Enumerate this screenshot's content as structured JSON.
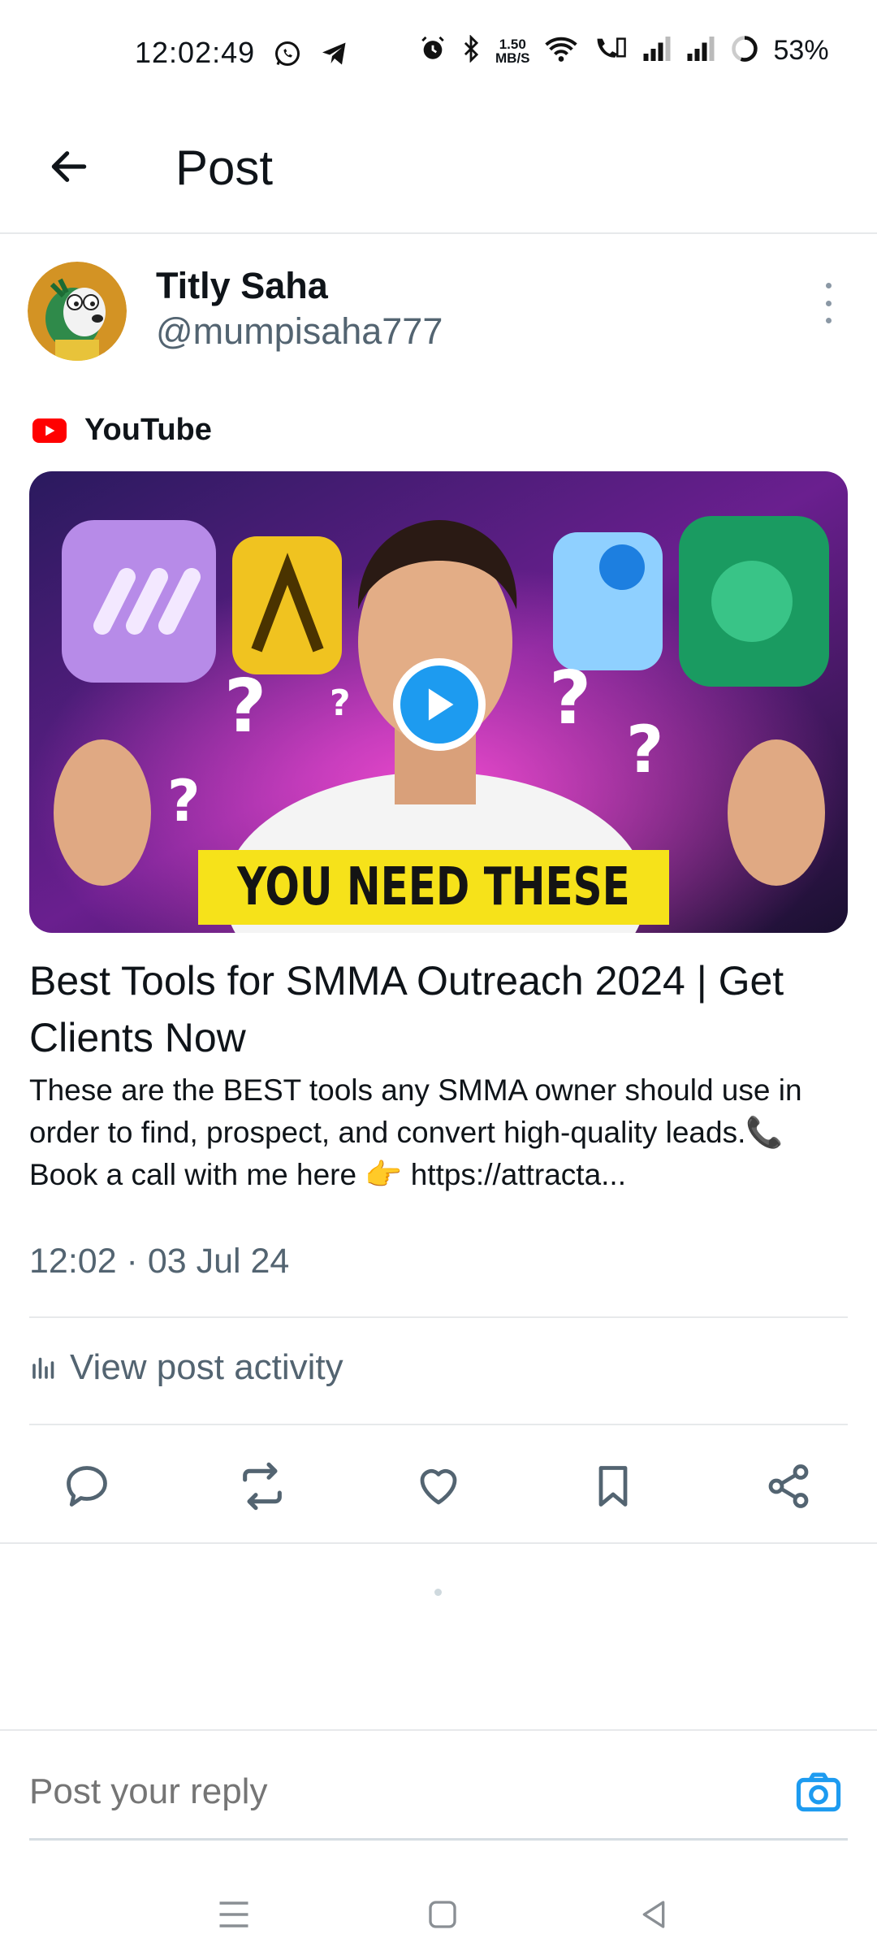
{
  "status_bar": {
    "time": "12:02:49",
    "speed_top": "1.50",
    "speed_bottom": "MB/S",
    "battery": "53%"
  },
  "header": {
    "title": "Post"
  },
  "post": {
    "author_name": "Titly Saha",
    "author_handle": "@mumpisaha777",
    "source": "YouTube",
    "thumbnail_banner": "YOU NEED THESE",
    "card_title": "Best Tools for SMMA Outreach 2024 | Get Clients Now",
    "card_description": "These are the BEST tools any SMMA owner should use in order to find, prospect, and convert high-quality leads.📞 Book a call with me here 👉 https://attracta...",
    "timestamp": "12:02 · 03 Jul 24",
    "activity_label": "View post activity"
  },
  "reply": {
    "placeholder": "Post your reply"
  },
  "colors": {
    "accent": "#1d9bf0",
    "secondary_text": "#536471",
    "youtube_red": "#ff0000",
    "banner_yellow": "#f6e21a"
  },
  "icons": {
    "back": "arrow-left-icon",
    "more": "more-vertical-icon",
    "reply": "comment-icon",
    "repost": "repost-icon",
    "like": "heart-icon",
    "bookmark": "bookmark-icon",
    "share": "share-icon",
    "camera": "camera-icon",
    "activity": "bar-chart-icon"
  }
}
